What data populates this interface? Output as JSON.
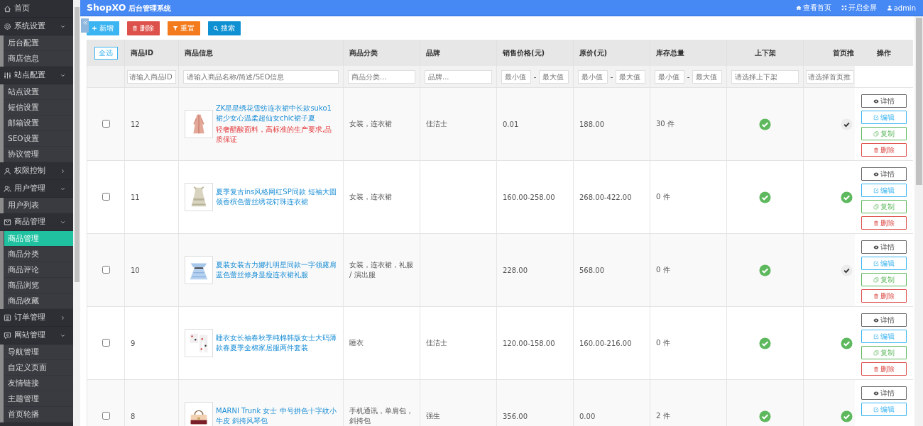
{
  "sidebar": {
    "items": [
      {
        "label": "首页",
        "kind": "home",
        "selected": false
      },
      {
        "label": "系统设置",
        "kind": "gear",
        "selected": false,
        "expanded": true,
        "children": [
          {
            "label": "后台配置",
            "selected": false
          },
          {
            "label": "商店信息",
            "selected": false
          }
        ]
      },
      {
        "label": "站点配置",
        "kind": "sliders",
        "selected": false,
        "expanded": true,
        "children": [
          {
            "label": "站点设置",
            "selected": false
          },
          {
            "label": "短信设置",
            "selected": false
          },
          {
            "label": "邮箱设置",
            "selected": false
          },
          {
            "label": "SEO设置",
            "selected": false
          },
          {
            "label": "协议管理",
            "selected": false
          }
        ]
      },
      {
        "label": "权限控制",
        "kind": "user",
        "selected": false,
        "expanded": false
      },
      {
        "label": "用户管理",
        "kind": "users",
        "selected": false,
        "expanded": true,
        "children": [
          {
            "label": "用户列表",
            "selected": false
          }
        ]
      },
      {
        "label": "商品管理",
        "kind": "tray",
        "selected": false,
        "expanded": true,
        "children": [
          {
            "label": "商品管理",
            "selected": true
          },
          {
            "label": "商品分类",
            "selected": false
          },
          {
            "label": "商品评论",
            "selected": false
          },
          {
            "label": "商品浏览",
            "selected": false
          },
          {
            "label": "商品收藏",
            "selected": false
          }
        ]
      },
      {
        "label": "订单管理",
        "kind": "list",
        "selected": false,
        "expanded": false
      },
      {
        "label": "网站管理",
        "kind": "chat",
        "selected": false,
        "expanded": true,
        "children": [
          {
            "label": "导航管理",
            "selected": false
          },
          {
            "label": "自定义页面",
            "selected": false
          },
          {
            "label": "友情链接",
            "selected": false
          },
          {
            "label": "主题管理",
            "selected": false
          },
          {
            "label": "首页轮播",
            "selected": false
          }
        ]
      }
    ]
  },
  "header": {
    "brand": "ShopXO",
    "subtitle": "后台管理系统",
    "links": [
      {
        "kind": "home",
        "label": "查看首页"
      },
      {
        "kind": "fullscreen",
        "label": "开启全屏"
      },
      {
        "kind": "user",
        "label": "admin"
      }
    ]
  },
  "toolbar": [
    {
      "kind": "add",
      "label": "新增"
    },
    {
      "kind": "delete",
      "label": "删除"
    },
    {
      "kind": "reset",
      "label": "重置"
    },
    {
      "kind": "search",
      "label": "搜索"
    }
  ],
  "table": {
    "columns": [
      {
        "kind": "select_all",
        "label": "全选"
      },
      {
        "kind": "text",
        "label": "商品ID",
        "filter": {
          "kind": "input",
          "placeholder": "请输入商品ID"
        }
      },
      {
        "kind": "text",
        "label": "商品信息",
        "filter": {
          "kind": "input",
          "placeholder": "请输入商品名称/简述/SEO信息"
        }
      },
      {
        "kind": "text",
        "label": "商品分类",
        "filter": {
          "kind": "input",
          "placeholder": "商品分类..."
        }
      },
      {
        "kind": "text",
        "label": "品牌",
        "filter": {
          "kind": "input",
          "placeholder": "品牌..."
        }
      },
      {
        "kind": "text",
        "label": "销售价格(元)",
        "filter": {
          "kind": "range",
          "min_placeholder": "最小值",
          "separator": "-",
          "max_placeholder": "最大值"
        }
      },
      {
        "kind": "text",
        "label": "原价(元)",
        "filter": {
          "kind": "range",
          "min_placeholder": "最小值",
          "separator": "-",
          "max_placeholder": "最大值"
        }
      },
      {
        "kind": "text",
        "label": "库存总量",
        "filter": {
          "kind": "range",
          "min_placeholder": "最小值",
          "separator": "-",
          "max_placeholder": "最大值"
        }
      },
      {
        "kind": "center",
        "label": "上下架",
        "filter": {
          "kind": "input",
          "placeholder": "请选择上下架"
        }
      },
      {
        "kind": "cut",
        "label": "首页推",
        "filter": {
          "kind": "input",
          "placeholder": "请选择首页推"
        }
      },
      {
        "kind": "actions",
        "label": "操作"
      }
    ],
    "rows": [
      {
        "checked": false,
        "id": "12",
        "title": "ZK星星绣花雪纺连衣裙中长款suko1裙少女心温柔超仙女chic裙子夏",
        "subtitle": "轻奢醋酸面料，高标准的生产要求,品质保证",
        "category": "女装，连衣裙",
        "brand": "佳洁士",
        "price": "0.01",
        "original_price": "188.00",
        "stock": "30 件",
        "on_shelf": true,
        "recommended": false,
        "actions": [
          {
            "kind": "detail",
            "label": "详情"
          },
          {
            "kind": "edit",
            "label": "编辑"
          },
          {
            "kind": "copy",
            "label": "复制"
          },
          {
            "kind": "delete",
            "label": "删除"
          }
        ]
      },
      {
        "checked": false,
        "id": "11",
        "title": "夏季复古ins风格网红SP同款 短袖大圆领香槟色蕾丝绣花钉珠连衣裙",
        "category": "女装，连衣裙",
        "price": "160.00-258.00",
        "original_price": "268.00-422.00",
        "stock": "0 件",
        "on_shelf": true,
        "recommended": true,
        "actions": [
          {
            "kind": "detail",
            "label": "详情"
          },
          {
            "kind": "edit",
            "label": "编辑"
          },
          {
            "kind": "copy",
            "label": "复制"
          },
          {
            "kind": "delete",
            "label": "删除"
          }
        ]
      },
      {
        "checked": false,
        "id": "10",
        "title": "夏装女装古力娜扎明星同款一字领露肩蓝色蕾丝修身显瘦连衣裙礼服",
        "category": "女装，连衣裙，礼服 / 演出服",
        "price": "228.00",
        "original_price": "568.00",
        "stock": "0 件",
        "on_shelf": true,
        "recommended": false,
        "actions": [
          {
            "kind": "detail",
            "label": "详情"
          },
          {
            "kind": "edit",
            "label": "编辑"
          },
          {
            "kind": "copy",
            "label": "复制"
          },
          {
            "kind": "delete",
            "label": "删除"
          }
        ]
      },
      {
        "checked": false,
        "id": "9",
        "title": "睡衣女长袖春秋季纯棉韩版女士大码薄款春夏季全棉家居服两件套装",
        "category": "睡衣",
        "brand": "佳洁士",
        "price": "120.00-158.00",
        "original_price": "160.00-216.00",
        "stock": "0 件",
        "on_shelf": true,
        "recommended": true,
        "actions": [
          {
            "kind": "detail",
            "label": "详情"
          },
          {
            "kind": "edit",
            "label": "编辑"
          },
          {
            "kind": "copy",
            "label": "复制"
          },
          {
            "kind": "delete",
            "label": "删除"
          }
        ]
      },
      {
        "checked": false,
        "id": "8",
        "title": "MARNI Trunk 女士 中号拼色十字纹小牛皮 斜挎风琴包",
        "category": "手机通讯，单肩包，斜挎包",
        "brand": "强生",
        "price": "356.00",
        "original_price": "0.00",
        "stock": "2 件",
        "on_shelf": true,
        "recommended": true,
        "actions": [
          {
            "kind": "detail",
            "label": "详情"
          },
          {
            "kind": "edit",
            "label": "编辑"
          }
        ]
      }
    ]
  }
}
